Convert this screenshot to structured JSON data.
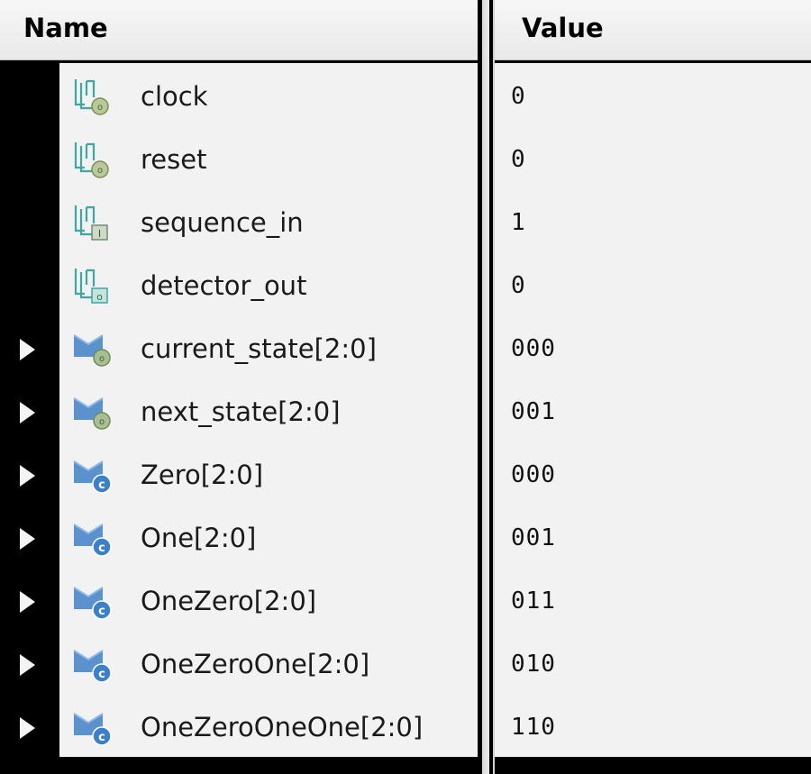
{
  "columns": {
    "name": "Name",
    "value": "Value"
  },
  "signals": [
    {
      "name": "clock",
      "value": "0",
      "icon": "scalar-in-icon",
      "expandable": false
    },
    {
      "name": "reset",
      "value": "0",
      "icon": "scalar-in-icon",
      "expandable": false
    },
    {
      "name": "sequence_in",
      "value": "1",
      "icon": "scalar-input-icon",
      "expandable": false
    },
    {
      "name": "detector_out",
      "value": "0",
      "icon": "scalar-output-icon",
      "expandable": false
    },
    {
      "name": "current_state[2:0]",
      "value": "000",
      "icon": "bus-signal-icon",
      "expandable": true
    },
    {
      "name": "next_state[2:0]",
      "value": "001",
      "icon": "bus-signal-icon",
      "expandable": true
    },
    {
      "name": "Zero[2:0]",
      "value": "000",
      "icon": "bus-constant-icon",
      "expandable": true
    },
    {
      "name": "One[2:0]",
      "value": "001",
      "icon": "bus-constant-icon",
      "expandable": true
    },
    {
      "name": "OneZero[2:0]",
      "value": "011",
      "icon": "bus-constant-icon",
      "expandable": true
    },
    {
      "name": "OneZeroOne[2:0]",
      "value": "010",
      "icon": "bus-constant-icon",
      "expandable": true
    },
    {
      "name": "OneZeroOneOne[2:0]",
      "value": "110",
      "icon": "bus-constant-icon",
      "expandable": true
    }
  ],
  "colors": {
    "background": "#000000",
    "row_background": "#f2f2f2",
    "header_background": "#efefef",
    "icon_blue": "#4a86c8",
    "icon_teal": "#3fa7a0"
  }
}
